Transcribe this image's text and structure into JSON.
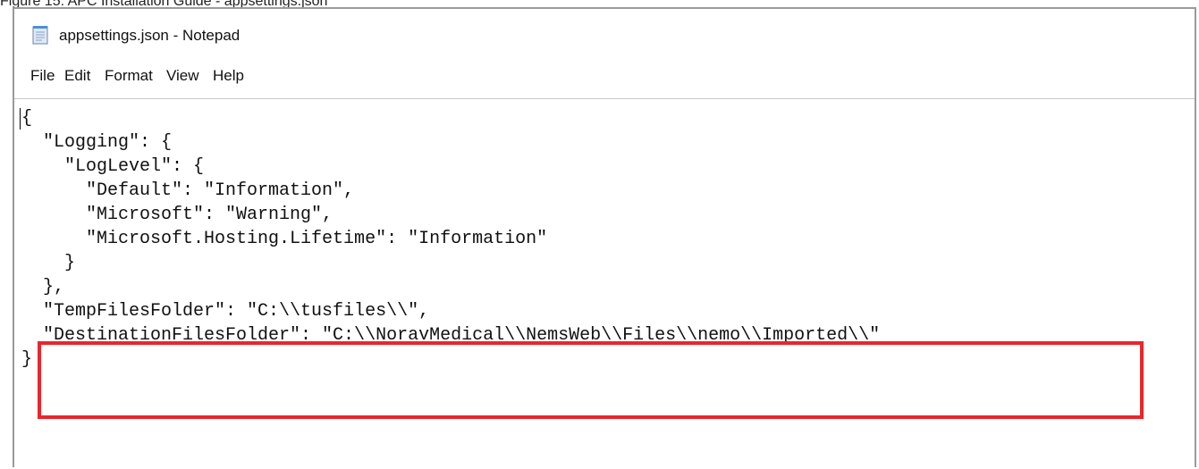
{
  "caption": "Figure 15: APC Installation Guide - appsettings.json",
  "window": {
    "title": "appsettings.json - Notepad",
    "app_icon": "notepad-icon"
  },
  "menu": {
    "items": [
      "File",
      "Edit",
      "Format",
      "View",
      "Help"
    ]
  },
  "editor": {
    "lines": [
      "{",
      "  \"Logging\": {",
      "    \"LogLevel\": {",
      "      \"Default\": \"Information\",",
      "      \"Microsoft\": \"Warning\",",
      "      \"Microsoft.Hosting.Lifetime\": \"Information\"",
      "    }",
      "  },",
      "  \"TempFilesFolder\": \"C:\\\\tusfiles\\\\\",",
      "  \"DestinationFilesFolder\": \"C:\\\\NoravMedical\\\\NemsWeb\\\\Files\\\\nemo\\\\Imported\\\\\"",
      "}"
    ]
  },
  "highlight": {
    "color": "#e8262b"
  }
}
